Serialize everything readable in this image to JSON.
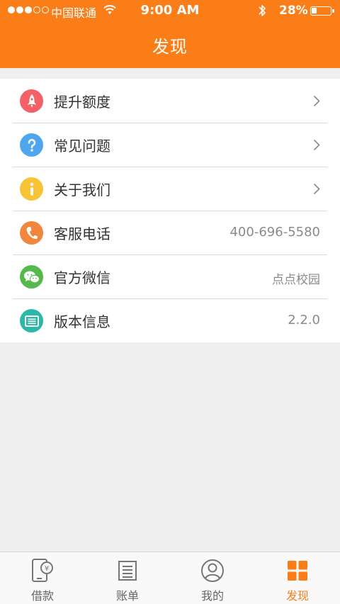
{
  "status_bar": {
    "carrier": "中国联通",
    "time": "9:00 AM",
    "battery_percent": "28%",
    "battery_level": 0.28,
    "signal_bars": 3,
    "signal_total": 5,
    "icons": [
      "signal-dots-icon",
      "wifi-icon",
      "bluetooth-icon",
      "battery-icon"
    ]
  },
  "header": {
    "title": "发现",
    "background_color": "#fb7d18"
  },
  "menu": {
    "items": [
      {
        "label": "提升额度",
        "icon": "rocket-icon",
        "color": "#f36167",
        "chevron": true
      },
      {
        "label": "常见问题",
        "icon": "question-icon",
        "color": "#4ea7ee",
        "chevron": true
      },
      {
        "label": "关于我们",
        "icon": "info-icon",
        "color": "#f6c434",
        "chevron": true
      },
      {
        "label": "客服电话",
        "icon": "phone-icon",
        "color": "#f0873d",
        "value": "400-696-5580"
      },
      {
        "label": "官方微信",
        "icon": "wechat-icon",
        "color": "#56b94d",
        "value": "点点校园"
      },
      {
        "label": "版本信息",
        "icon": "version-icon",
        "color": "#2bb8a7",
        "value": "2.2.0"
      }
    ]
  },
  "tabbar": {
    "active_color": "#fb7d18",
    "items": [
      {
        "label": "借款",
        "icon": "phone-yen-icon",
        "active": false
      },
      {
        "label": "账单",
        "icon": "bill-icon",
        "active": false
      },
      {
        "label": "我的",
        "icon": "user-icon",
        "active": false
      },
      {
        "label": "发现",
        "icon": "grid-icon",
        "active": true
      }
    ]
  }
}
